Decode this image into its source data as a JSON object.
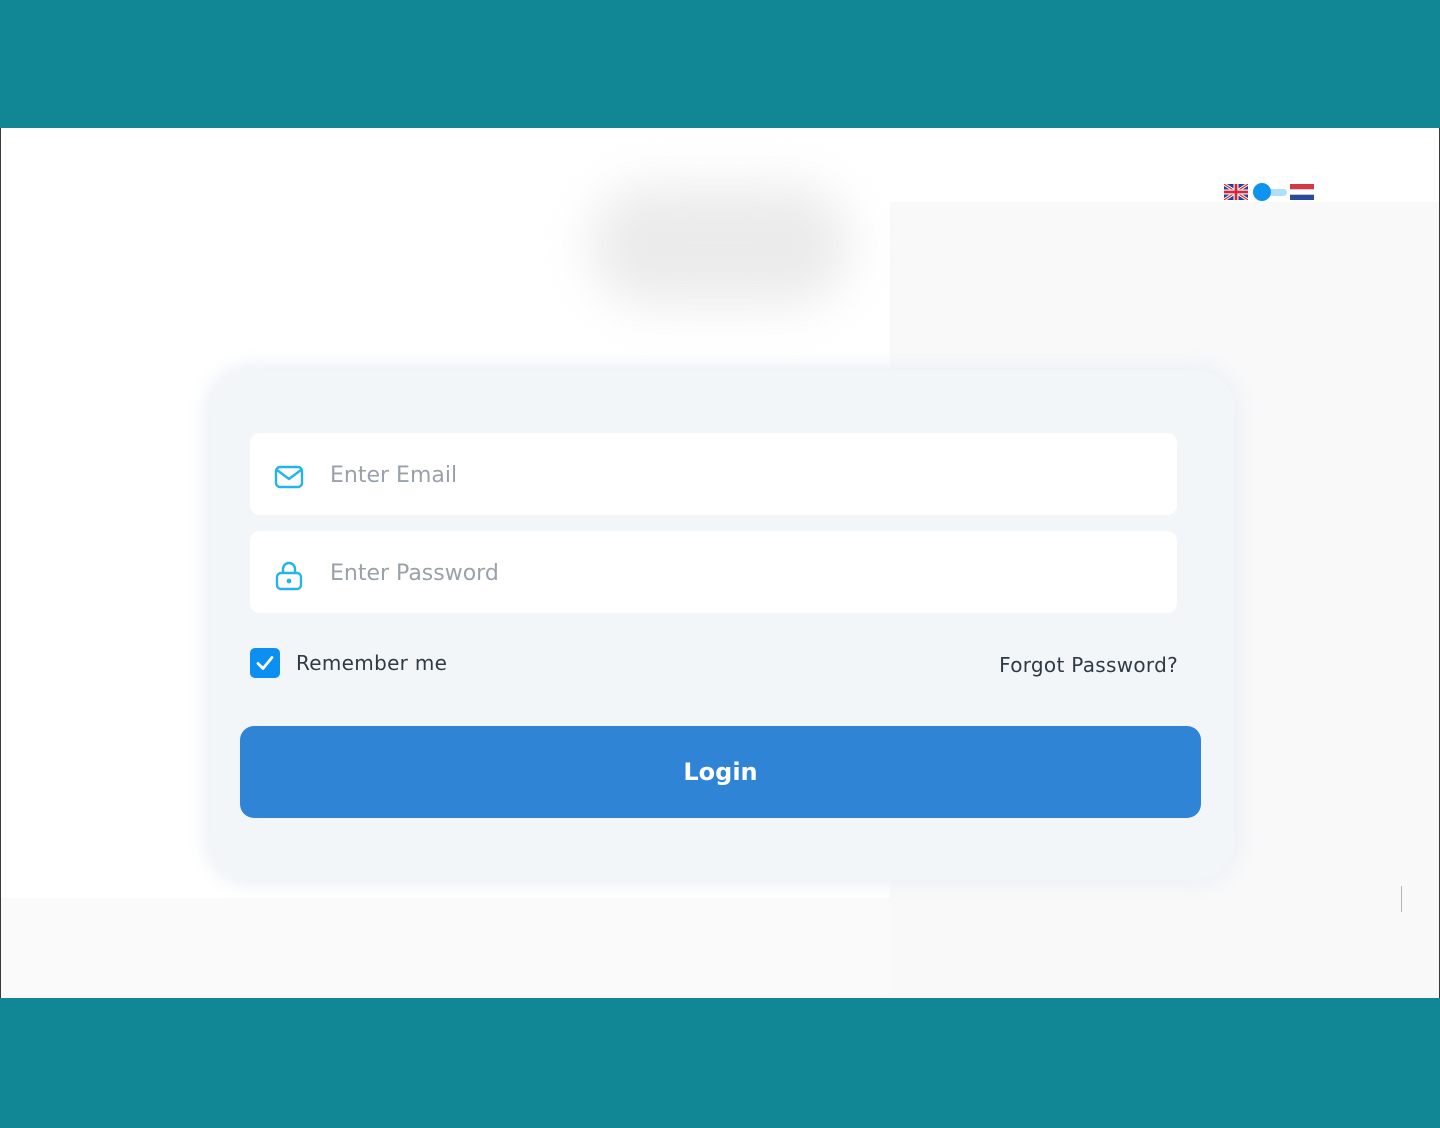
{
  "colors": {
    "header_band": "#118695",
    "card_background": "#f3f6f9",
    "login_button": "#2f84d6",
    "checkbox": "#0b8ff0",
    "input_icon": "#23b5ea",
    "toggle_knob": "#0f93ef"
  },
  "header": {},
  "language_switch": {
    "left_flag": "uk-flag-icon",
    "right_flag": "netherlands-flag-icon",
    "selected": "left"
  },
  "logo": {
    "state": "blurred"
  },
  "login_form": {
    "email": {
      "placeholder": "Enter Email",
      "value": "",
      "icon": "envelope-icon"
    },
    "password": {
      "placeholder": "Enter Password",
      "value": "",
      "icon": "lock-icon"
    },
    "remember_me": {
      "label": "Remember me",
      "checked": true
    },
    "forgot_password": "Forgot Password?",
    "submit_label": "Login"
  },
  "footer": {}
}
